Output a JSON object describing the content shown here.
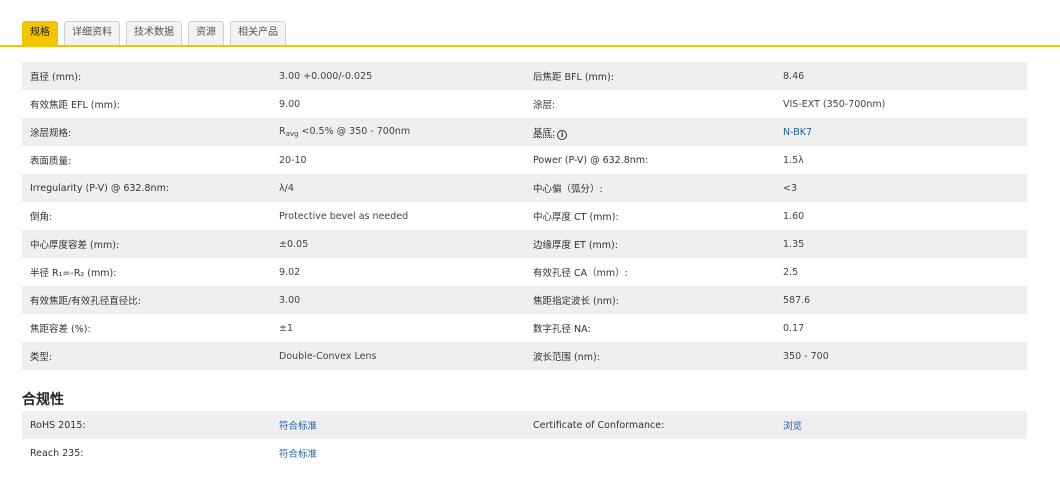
{
  "tabs": [
    {
      "label": "规格",
      "active": true
    },
    {
      "label": "详细资料",
      "active": false
    },
    {
      "label": "技术数据",
      "active": false
    },
    {
      "label": "资源",
      "active": false
    },
    {
      "label": "相关产品",
      "active": false
    }
  ],
  "accent_color": "#f5c400",
  "link_color": "#1d5fa8",
  "specs": {
    "r1": {
      "l1": "直径 (mm):",
      "v1": "3.00 +0.000/-0.025",
      "l2": "后焦距 BFL (mm):",
      "v2": "8.46"
    },
    "r2": {
      "l1": "有效焦距 EFL (mm):",
      "v1": "9.00",
      "l2": "涂层:",
      "v2": "VIS-EXT (350-700nm)"
    },
    "r3": {
      "l1": "涂层规格:",
      "v1_r": "R",
      "v1_sub": "avg",
      "v1_rest": " <0.5% @ 350 - 700nm",
      "l2": "基底:",
      "info_glyph": "i",
      "v2": "N-BK7"
    },
    "r4": {
      "l1": "表面质量:",
      "v1": "20-10",
      "l2": "Power (P-V) @ 632.8nm:",
      "v2": "1.5λ"
    },
    "r5": {
      "l1": "Irregularity (P-V) @ 632.8nm:",
      "v1": "λ/4",
      "l2": "中心偏（弧分）:",
      "v2": "<3"
    },
    "r6": {
      "l1": "倒角:",
      "v1": "Protective bevel as needed",
      "l2": "中心厚度 CT (mm):",
      "v2": "1.60"
    },
    "r7": {
      "l1": "中心厚度容差 (mm):",
      "v1": "±0.05",
      "l2": "边缘厚度 ET (mm):",
      "v2": "1.35"
    },
    "r8": {
      "l1": "半径 R₁=-R₂ (mm):",
      "v1": "9.02",
      "l2": "有效孔径 CA（mm）:",
      "v2": "2.5"
    },
    "r9": {
      "l1": "有效焦距/有效孔径直径比:",
      "v1": "3.00",
      "l2": "焦距指定波长 (nm):",
      "v2": "587.6"
    },
    "r10": {
      "l1": "焦距容差 (%):",
      "v1": "±1",
      "l2": "数字孔径 NA:",
      "v2": "0.17"
    },
    "r11": {
      "l1": "类型:",
      "v1": "Double-Convex Lens",
      "l2": "波长范围 (nm):",
      "v2": "350 - 700"
    }
  },
  "compliance": {
    "title": "合规性",
    "r1": {
      "l1": "RoHS 2015:",
      "v1": "符合标准",
      "l2": "Certificate of Conformance:",
      "v2": "浏览"
    },
    "r2": {
      "l1": "Reach 235:",
      "v1": "符合标准"
    }
  }
}
